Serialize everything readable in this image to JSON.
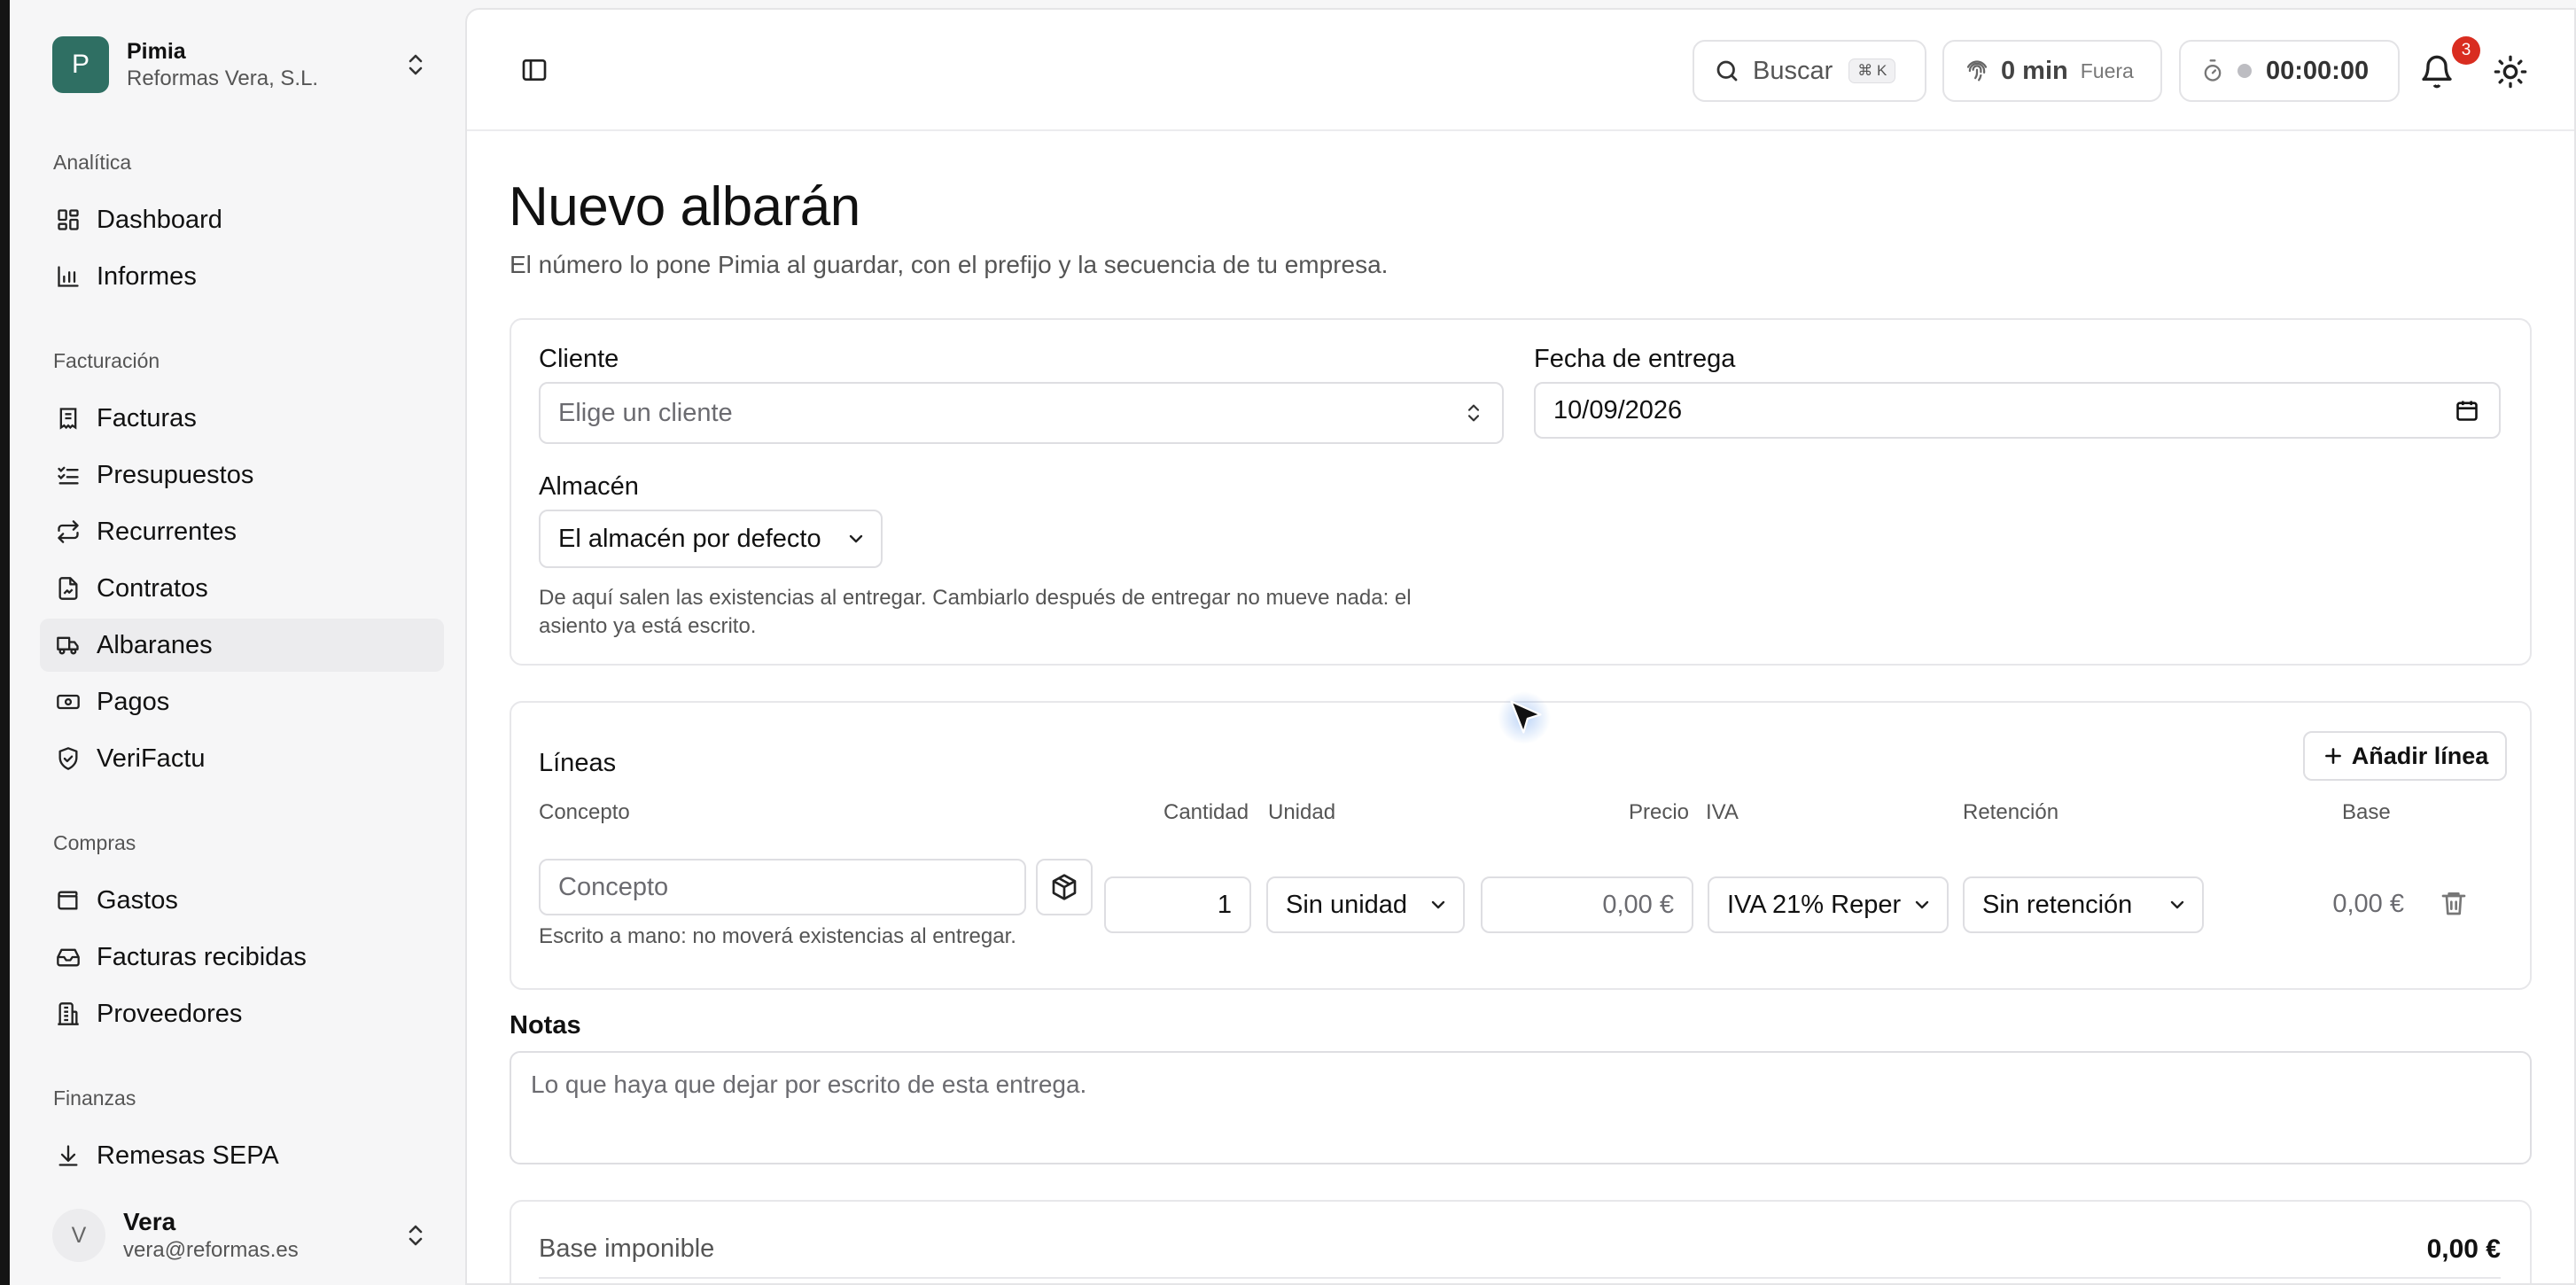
{
  "org": {
    "initial": "P",
    "name": "Pimia",
    "company": "Reformas Vera, S.L."
  },
  "sidebar": {
    "sections": [
      {
        "label": "Analítica",
        "items": [
          {
            "label": "Dashboard",
            "icon": "dashboard-icon"
          },
          {
            "label": "Informes",
            "icon": "bar-chart-icon"
          }
        ]
      },
      {
        "label": "Facturación",
        "items": [
          {
            "label": "Facturas",
            "icon": "invoice-icon"
          },
          {
            "label": "Presupuestos",
            "icon": "checklist-icon"
          },
          {
            "label": "Recurrentes",
            "icon": "repeat-icon"
          },
          {
            "label": "Contratos",
            "icon": "contract-icon"
          },
          {
            "label": "Albaranes",
            "icon": "truck-icon",
            "active": true
          },
          {
            "label": "Pagos",
            "icon": "banknote-icon"
          },
          {
            "label": "VeriFactu",
            "icon": "shield-check-icon"
          }
        ]
      },
      {
        "label": "Compras",
        "items": [
          {
            "label": "Gastos",
            "icon": "wallet-icon"
          },
          {
            "label": "Facturas recibidas",
            "icon": "inbox-icon"
          },
          {
            "label": "Proveedores",
            "icon": "building-icon"
          }
        ]
      },
      {
        "label": "Finanzas",
        "items": [
          {
            "label": "Remesas SEPA",
            "icon": "download-icon"
          }
        ]
      }
    ]
  },
  "user": {
    "initial": "V",
    "name": "Vera",
    "email": "vera@reformas.es"
  },
  "topbar": {
    "search_label": "Buscar",
    "search_shortcut": "⌘ K",
    "clock_value": "0 min",
    "clock_status": "Fuera",
    "timer_value": "00:00:00",
    "notifications_count": "3"
  },
  "page": {
    "title": "Nuevo albarán",
    "subtitle": "El número lo pone Pimia al guardar, con el prefijo y la secuencia de tu empresa."
  },
  "form": {
    "client_label": "Cliente",
    "client_placeholder": "Elige un cliente",
    "delivery_date_label": "Fecha de entrega",
    "delivery_date_value": "10/09/2026",
    "warehouse_label": "Almacén",
    "warehouse_value": "El almacén por defecto",
    "warehouse_help_1": "De aquí salen las existencias al entregar. Cambiarlo después de entregar no mueve nada: el",
    "warehouse_help_2": "asiento ya está escrito."
  },
  "lines": {
    "title": "Líneas",
    "add_button": "Añadir línea",
    "columns": {
      "concept": "Concepto",
      "quantity": "Cantidad",
      "unit": "Unidad",
      "price": "Precio",
      "vat": "IVA",
      "withholding": "Retención",
      "base": "Base"
    },
    "row": {
      "concept_placeholder": "Concepto",
      "concept_help": "Escrito a mano: no moverá existencias al entregar.",
      "quantity": "1",
      "unit": "Sin unidad",
      "price": "0,00 €",
      "vat": "IVA 21% Reper",
      "withholding": "Sin retención",
      "base": "0,00 €"
    }
  },
  "notes": {
    "label": "Notas",
    "placeholder": "Lo que haya que dejar por escrito de esta entrega."
  },
  "totals": {
    "taxable_base_label": "Base imponible",
    "taxable_base_value": "0,00 €"
  },
  "colors": {
    "brand": "#2f6f63",
    "badge": "#d92d20"
  }
}
